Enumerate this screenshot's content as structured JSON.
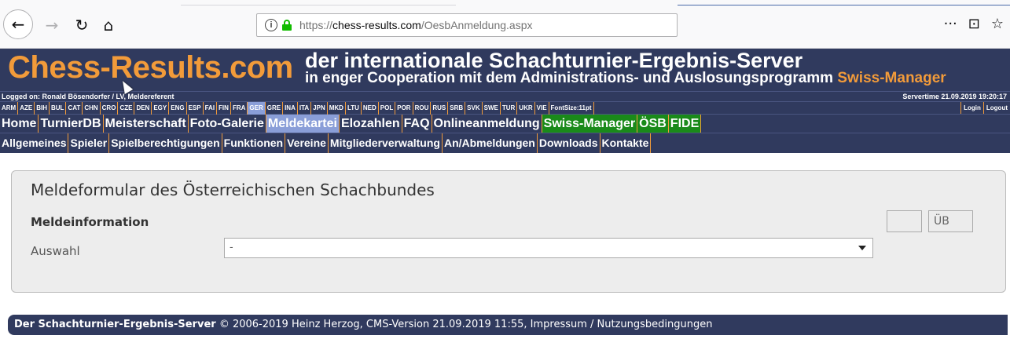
{
  "browser": {
    "url_prefix": "https://",
    "url_host": "chess-results.com",
    "url_path": "/OesbAnmeldung.aspx",
    "icons": [
      "back-icon",
      "forward-icon",
      "reload-icon",
      "home-icon",
      "info-icon",
      "lock-icon",
      "more-icon",
      "pocket-icon",
      "bookmark-star-icon"
    ],
    "more_label": "···",
    "pocket_label": "⊡",
    "star_label": "☆"
  },
  "header": {
    "logo": "Chess-Results.com",
    "tagline1": "der internationale Schachturnier-Ergebnis-Server",
    "tagline2_prefix": "in enger Cooperation mit dem Administrations- und Auslosungsprogramm ",
    "tagline2_highlight": "Swiss-Manager",
    "logged_on": "Logged on: Ronald Bösendorfer / LV, Meldereferent",
    "servertime": "Servertime 21.09.2019 19:20:17",
    "login": "Login",
    "logout": "Logout"
  },
  "languages": [
    "ARM",
    "AZE",
    "BIH",
    "BUL",
    "CAT",
    "CHN",
    "CRO",
    "CZE",
    "DEN",
    "EGY",
    "ENG",
    "ESP",
    "FAI",
    "FIN",
    "FRA",
    "GER",
    "GRE",
    "INA",
    "ITA",
    "JPN",
    "MKD",
    "LTU",
    "NED",
    "POL",
    "POR",
    "ROU",
    "RUS",
    "SRB",
    "SVK",
    "SWE",
    "TUR",
    "UKR",
    "VIE",
    "FontSize:11pt"
  ],
  "active_language": "GER",
  "menu1": [
    "Home",
    "TurnierDB",
    "Meisterschaft",
    "Foto-Galerie",
    "Meldekartei",
    "Elozahlen",
    "FAQ",
    "Onlineanmeldung",
    "Swiss-Manager",
    "ÖSB",
    "FIDE"
  ],
  "menu1_active": "Meldekartei",
  "menu1_green": [
    "Swiss-Manager",
    "ÖSB",
    "FIDE"
  ],
  "menu2": [
    "Allgemeines",
    "Spieler",
    "Spielberechtigungen",
    "Funktionen",
    "Vereine",
    "Mitgliederverwaltung",
    "An/Abmeldungen",
    "Downloads",
    "Kontakte"
  ],
  "form": {
    "title": "Meldeformular des Österreichischen Schachbundes",
    "section": "Meldeinformation",
    "auswahl_label": "Auswahl",
    "auswahl_value": "-",
    "ub_label": "ÜB"
  },
  "footer": {
    "brand": "Der Schachturnier-Ergebnis-Server",
    "text": " © 2006-2019 Heinz Herzog, CMS-Version 21.09.2019 11:55, Impressum / Nutzungsbedingungen"
  },
  "colors": {
    "navy": "#303a5e",
    "orange": "#f29b3a",
    "active": "#8a9ed8",
    "green": "#1a8a1a"
  }
}
